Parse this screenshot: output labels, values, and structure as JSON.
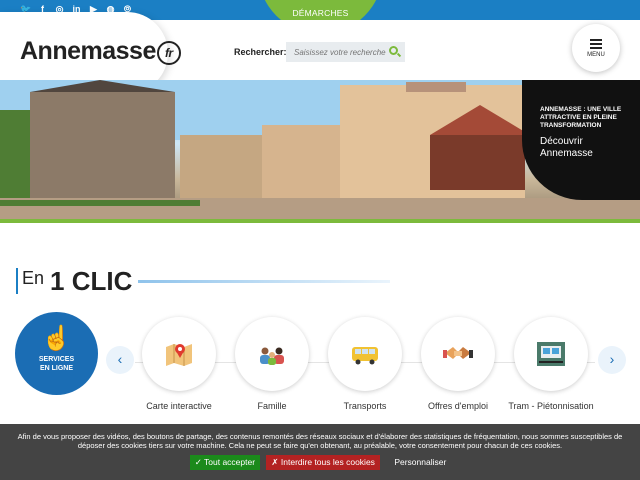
{
  "social": {
    "icons": [
      "f",
      "ig",
      "in",
      "yt",
      "sc",
      "wf"
    ]
  },
  "demarches": {
    "label": "DÉMARCHES",
    "chevron": "⌄"
  },
  "header": {
    "logo_text": "Annemasse",
    "logo_suffix": "fr",
    "search_label": "Rechercher:",
    "search_placeholder": "Saisissez votre recherche",
    "menu_label": "MENU"
  },
  "hero": {
    "tagline": "ANNEMASSE : UNE VILLE ATTRACTIVE EN PLEINE TRANSFORMATION",
    "cta": "Découvrir Annemasse"
  },
  "section": {
    "prefix": "En",
    "title": "1 CLIC"
  },
  "services": {
    "label_line1": "SERVICES",
    "label_line2": "EN LIGNE"
  },
  "carousel": {
    "prev": "‹",
    "next": "›",
    "items": [
      {
        "label": "Carte interactive",
        "icon": "map-icon"
      },
      {
        "label": "Famille",
        "icon": "family-icon"
      },
      {
        "label": "Transports",
        "icon": "bus-icon"
      },
      {
        "label": "Offres d'emploi",
        "icon": "handshake-icon"
      },
      {
        "label": "Tram - Piétonnisation",
        "icon": "tram-icon"
      }
    ]
  },
  "cookie": {
    "text": "Afin de vous proposer des vidéos, des boutons de partage, des contenus remontés des réseaux sociaux et d'élaborer des statistiques de fréquentation, nous sommes susceptibles de déposer des cookies tiers sur votre machine. Cela ne peut se faire qu'en obtenant, au préalable, votre consentement pour chacun de ces cookies.",
    "accept": "✓ Tout accepter",
    "deny": "✗ Interdire tous les cookies",
    "customize": "Personnaliser"
  },
  "colors": {
    "brand_blue": "#1b7fc4",
    "brand_green": "#7cba3c",
    "dark": "#111111"
  }
}
